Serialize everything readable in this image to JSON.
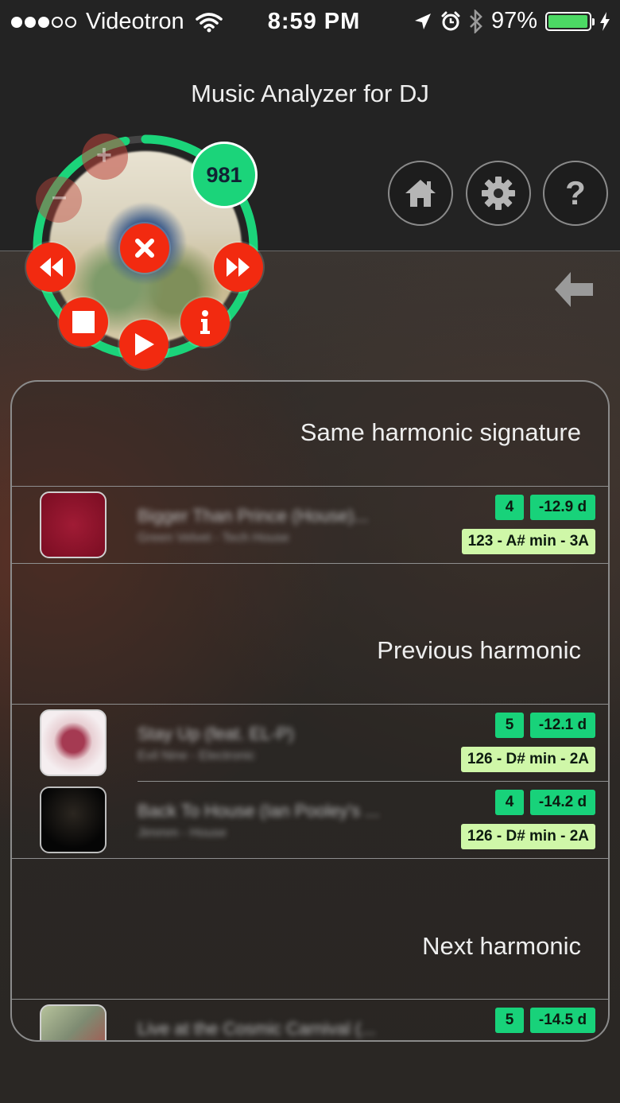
{
  "status": {
    "carrier": "Videotron",
    "time": "8:59 PM",
    "battery": "97%",
    "battery_level": 0.97,
    "signal_bars": 3,
    "signal_total": 5
  },
  "header": {
    "title": "Music Analyzer for DJ",
    "buttons": [
      "home-icon",
      "gear-icon",
      "help-icon"
    ],
    "help_glyph": "?"
  },
  "player": {
    "count": "981",
    "progress": 0.97,
    "accent": "#1bd47a",
    "control_color": "#f22a10",
    "controls": [
      "rewind",
      "close",
      "fast-forward",
      "stop",
      "play",
      "info"
    ]
  },
  "sections": [
    {
      "title": "Same harmonic signature",
      "tracks": [
        {
          "title": "Bigger Than Prince (House)...",
          "artist": "Green Velvet - Tech House",
          "energy": "4",
          "delta": "-12.9 d",
          "key": "123 - A# min - 3A"
        }
      ]
    },
    {
      "title": "Previous harmonic",
      "tracks": [
        {
          "title": "Stay Up (feat. EL-P)",
          "artist": "Evil Nine - Electronic",
          "energy": "5",
          "delta": "-12.1 d",
          "key": "126 - D# min - 2A"
        },
        {
          "title": "Back To House (Ian Pooley's ...",
          "artist": "Jimmm - House",
          "energy": "4",
          "delta": "-14.2 d",
          "key": "126 - D# min - 2A"
        }
      ]
    },
    {
      "title": "Next harmonic",
      "tracks": [
        {
          "title": "Live at the Cosmic Carnival (...",
          "artist": "",
          "energy": "5",
          "delta": "-14.5 d",
          "key": ""
        }
      ]
    }
  ],
  "colors": {
    "tag_green": "#18d27a",
    "tag_light": "#cff7a8"
  }
}
